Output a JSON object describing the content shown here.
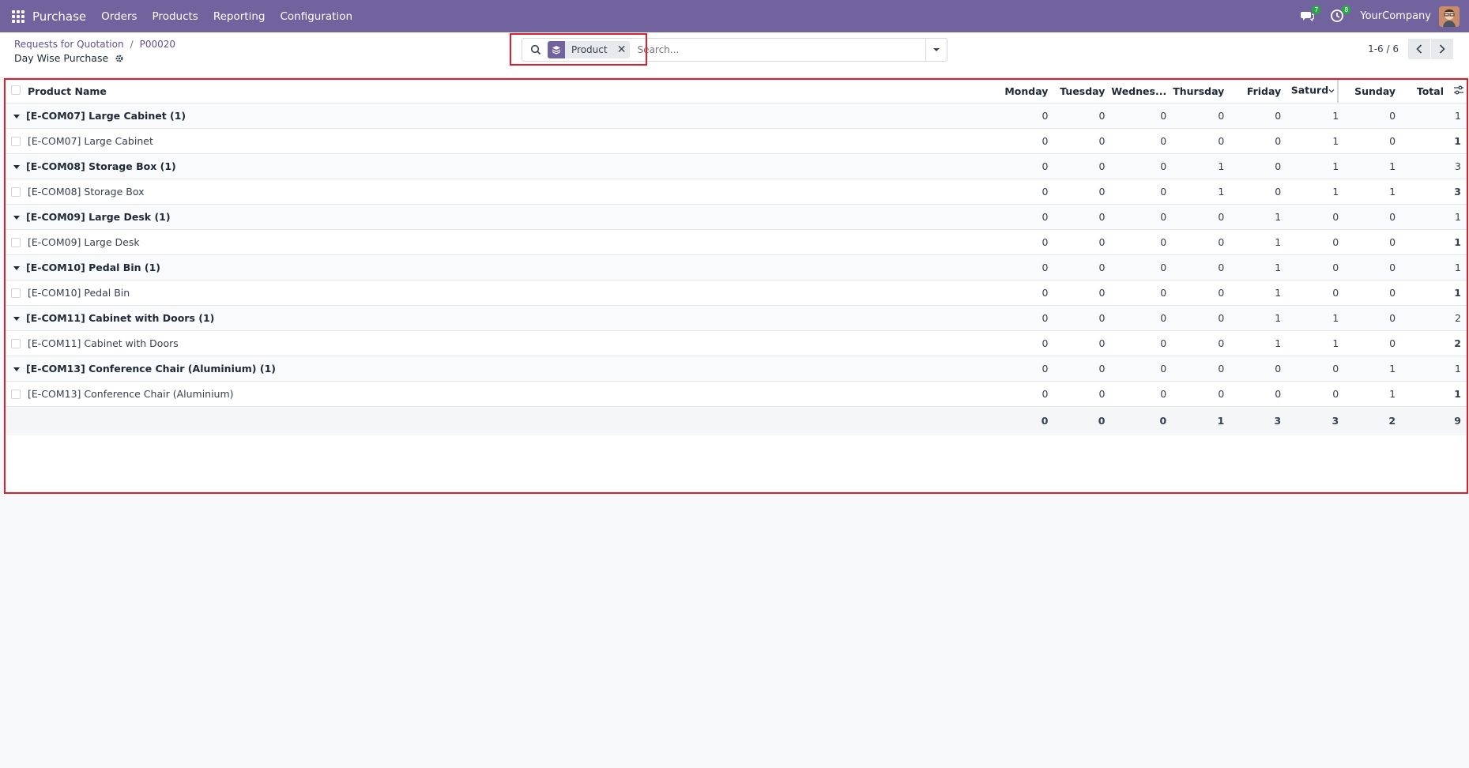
{
  "navbar": {
    "brand": "Purchase",
    "menu": [
      "Orders",
      "Products",
      "Reporting",
      "Configuration"
    ],
    "messages_count": "7",
    "activities_count": "8",
    "company": "YourCompany"
  },
  "control_panel": {
    "breadcrumb": [
      "Requests for Quotation",
      "P00020"
    ],
    "title": "Day Wise Purchase",
    "search": {
      "facet_label": "Product",
      "placeholder": "Search..."
    },
    "pager": "1-6 / 6"
  },
  "table": {
    "columns": [
      "Product Name",
      "Monday",
      "Tuesday",
      "Wednes...",
      "Thursday",
      "Friday",
      "Saturd",
      "Sunday",
      "Total"
    ],
    "groups": [
      {
        "label": "[E-COM07] Large Cabinet (1)",
        "values": [
          "0",
          "0",
          "0",
          "0",
          "0",
          "1",
          "0",
          "1"
        ],
        "record": {
          "name": "[E-COM07] Large Cabinet",
          "values": [
            "0",
            "0",
            "0",
            "0",
            "0",
            "1",
            "0",
            "1"
          ]
        }
      },
      {
        "label": "[E-COM08] Storage Box (1)",
        "values": [
          "0",
          "0",
          "0",
          "1",
          "0",
          "1",
          "1",
          "3"
        ],
        "record": {
          "name": "[E-COM08] Storage Box",
          "values": [
            "0",
            "0",
            "0",
            "1",
            "0",
            "1",
            "1",
            "3"
          ]
        }
      },
      {
        "label": "[E-COM09] Large Desk (1)",
        "values": [
          "0",
          "0",
          "0",
          "0",
          "1",
          "0",
          "0",
          "1"
        ],
        "record": {
          "name": "[E-COM09] Large Desk",
          "values": [
            "0",
            "0",
            "0",
            "0",
            "1",
            "0",
            "0",
            "1"
          ]
        }
      },
      {
        "label": "[E-COM10] Pedal Bin (1)",
        "values": [
          "0",
          "0",
          "0",
          "0",
          "1",
          "0",
          "0",
          "1"
        ],
        "record": {
          "name": "[E-COM10] Pedal Bin",
          "values": [
            "0",
            "0",
            "0",
            "0",
            "1",
            "0",
            "0",
            "1"
          ]
        }
      },
      {
        "label": "[E-COM11] Cabinet with Doors (1)",
        "values": [
          "0",
          "0",
          "0",
          "0",
          "1",
          "1",
          "0",
          "2"
        ],
        "record": {
          "name": "[E-COM11] Cabinet with Doors",
          "values": [
            "0",
            "0",
            "0",
            "0",
            "1",
            "1",
            "0",
            "2"
          ]
        }
      },
      {
        "label": "[E-COM13] Conference Chair (Aluminium) (1)",
        "values": [
          "0",
          "0",
          "0",
          "0",
          "0",
          "0",
          "1",
          "1"
        ],
        "record": {
          "name": "[E-COM13] Conference Chair (Aluminium)",
          "values": [
            "0",
            "0",
            "0",
            "0",
            "0",
            "0",
            "1",
            "1"
          ]
        }
      }
    ],
    "totals": [
      "0",
      "0",
      "0",
      "1",
      "3",
      "3",
      "2",
      "9"
    ]
  },
  "colors": {
    "navbar": "#71639e",
    "highlight": "#e11d2a",
    "badge": "#28a745"
  }
}
